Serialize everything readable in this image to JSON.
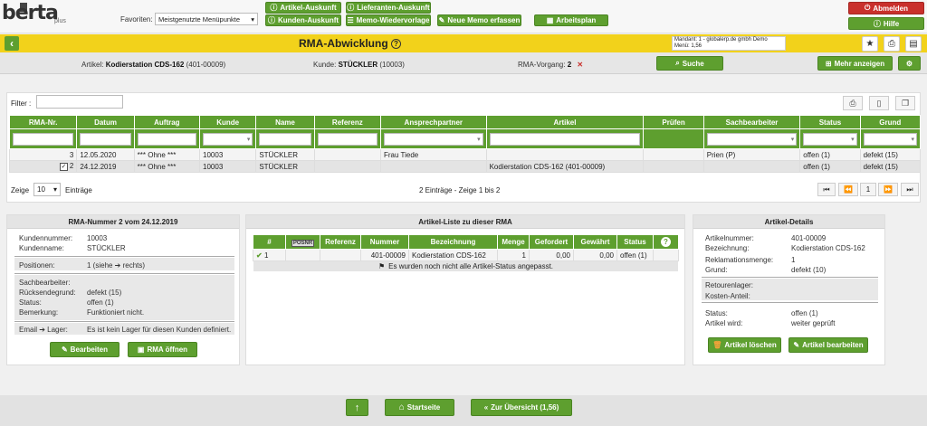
{
  "header": {
    "logo_text": "berta",
    "logo_sub": "plus",
    "favorites_label": "Favoriten:",
    "favorites_value": "Meistgenutzte Menüpunkte",
    "buttons": {
      "artikel_auskunft": "Artikel-Auskunft",
      "lieferanten_auskunft": "Lieferanten-Auskunft",
      "kunden_auskunft": "Kunden-Auskunft",
      "memo_wiedervorlage": "Memo-Wiedervorlage",
      "neue_memo": "Neue Memo erfassen",
      "arbeitsplan": "Arbeitsplan",
      "abmelden": "Abmelden",
      "hilfe": "Hilfe"
    }
  },
  "titlebar": {
    "title": "RMA-Abwicklung",
    "mandant_line1": "Mandant: 1 - globalerp.de gmbh Demo",
    "mandant_line2": "Menü: 1,56"
  },
  "context": {
    "artikel_label": "Artikel:",
    "artikel_value": "Kodierstation CDS-162",
    "artikel_code": "(401-00009)",
    "kunde_label": "Kunde:",
    "kunde_value": "STÜCKLER",
    "kunde_code": "(10003)",
    "vorgang_label": "RMA-Vorgang:",
    "vorgang_value": "2",
    "suche": "Suche",
    "mehr_anzeigen": "Mehr anzeigen"
  },
  "list": {
    "filter_label": "Filter :",
    "columns": [
      "RMA-Nr.",
      "Datum",
      "Auftrag",
      "Kunde",
      "Name",
      "Referenz",
      "Ansprechpartner",
      "Artikel",
      "Prüfen",
      "Sachbearbeiter",
      "Status",
      "Grund"
    ],
    "rows": [
      {
        "nr": "3",
        "datum": "12.05.2020",
        "auftrag": "*** Ohne ***",
        "kunde": "10003",
        "name": "STÜCKLER",
        "referenz": "",
        "ansprech": "Frau Tiede",
        "artikel": "",
        "pruefen": "",
        "sach": "Prien (P)",
        "status": "offen (1)",
        "grund": "defekt (15)"
      },
      {
        "nr": "2",
        "datum": "24.12.2019",
        "auftrag": "*** Ohne ***",
        "kunde": "10003",
        "name": "STÜCKLER",
        "referenz": "",
        "ansprech": "",
        "artikel": "Kodierstation CDS-162 (401-00009)",
        "pruefen": "",
        "sach": "",
        "status": "offen (1)",
        "grund": "defekt (15)"
      }
    ],
    "zeige_label": "Zeige",
    "zeige_value": "10",
    "eintraege_label": "Einträge",
    "page_info": "2 Einträge - Zeige 1 bis 2",
    "current_page": "1"
  },
  "rma_card": {
    "title": "RMA-Nummer 2 vom 24.12.2019",
    "kundennummer_label": "Kundennummer:",
    "kundennummer_value": "10003",
    "kundenname_label": "Kundenname:",
    "kundenname_value": "STÜCKLER",
    "positionen_label": "Positionen:",
    "positionen_value": "1 (siehe ➔ rechts)",
    "sachbearbeiter_label": "Sachbearbeiter:",
    "ruecksendegrund_label": "Rücksendegrund:",
    "ruecksendegrund_value": "defekt (15)",
    "status_label": "Status:",
    "status_value": "offen (1)",
    "bemerkung_label": "Bemerkung:",
    "bemerkung_value": "Funktioniert nicht.",
    "email_label": "Email ➔ Lager:",
    "email_value": "Es ist kein Lager für diesen Kunden definiert.",
    "bearbeiten": "Bearbeiten",
    "rma_oeffnen": "RMA öffnen"
  },
  "artikel_list": {
    "title": "Artikel-Liste zu dieser RMA",
    "columns": [
      "#",
      "POSNR",
      "Referenz",
      "Nummer",
      "Bezeichnung",
      "Menge",
      "Gefordert",
      "Gewährt",
      "Status",
      "?"
    ],
    "rows": [
      {
        "idx": "1",
        "posnr": "",
        "referenz": "",
        "nummer": "401-00009",
        "bezeichnung": "Kodierstation CDS-162",
        "menge": "1",
        "gefordert": "0,00",
        "gewaehrt": "0,00",
        "status": "offen (1)"
      }
    ],
    "note": "Es wurden noch nicht alle Artikel-Status angepasst."
  },
  "artikel_details": {
    "title": "Artikel-Details",
    "artikelnummer_label": "Artikelnummer:",
    "artikelnummer_value": "401-00009",
    "bezeichnung_label": "Bezeichnung:",
    "bezeichnung_value": "Kodierstation CDS-162",
    "reklamationsmenge_label": "Reklamationsmenge:",
    "reklamationsmenge_value": "1",
    "grund_label": "Grund:",
    "grund_value": "defekt (10)",
    "retourenlager_label": "Retourenlager:",
    "kosten_label": "Kosten-Anteil:",
    "status_label": "Status:",
    "status_value": "offen (1)",
    "artikel_wird_label": "Artikel wird:",
    "artikel_wird_value": "weiter geprüft",
    "loeschen": "Artikel löschen",
    "bearbeiten": "Artikel bearbeiten"
  },
  "footer": {
    "startseite": "Startseite",
    "uebersicht": "Zur Übersicht (1,56)"
  },
  "colors": {
    "accent_green": "#5e9f2f",
    "title_yellow": "#f2d21b",
    "danger_red": "#c9302c"
  }
}
